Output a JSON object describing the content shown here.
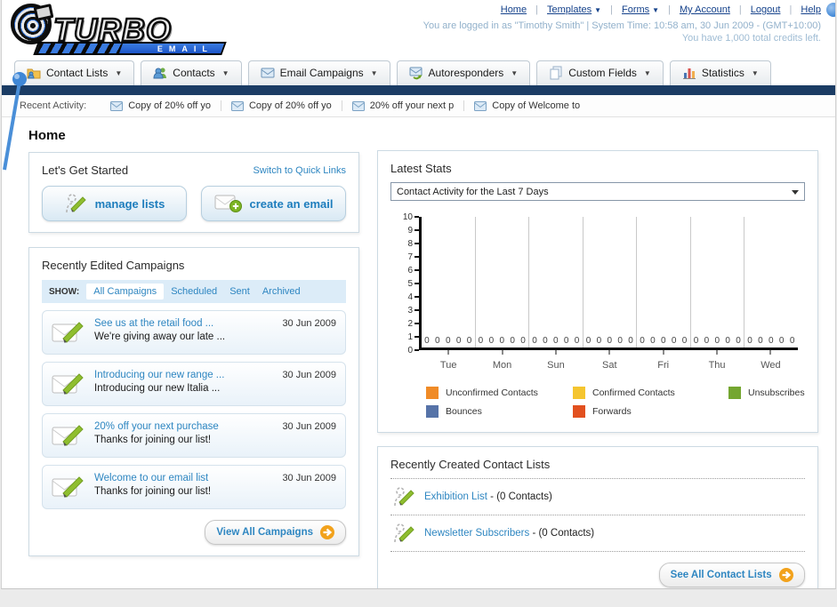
{
  "logo": {
    "brand": "TURBO",
    "sub": "EMAIL"
  },
  "topnav": {
    "links": [
      {
        "label": "Home",
        "dropdown": false
      },
      {
        "label": "Templates",
        "dropdown": true
      },
      {
        "label": "Forms",
        "dropdown": true
      },
      {
        "label": "My Account",
        "dropdown": false
      },
      {
        "label": "Logout",
        "dropdown": false
      },
      {
        "label": "Help",
        "dropdown": false
      }
    ],
    "session_line": "You are logged in as \"Timothy Smith\" | System Time: 10:58 am, 30 Jun 2009 - (GMT+10:00)",
    "credits_line": "You have 1,000 total credits left."
  },
  "main_tabs": [
    {
      "label": "Contact Lists",
      "icon": "contact-lists-icon"
    },
    {
      "label": "Contacts",
      "icon": "contacts-icon"
    },
    {
      "label": "Email Campaigns",
      "icon": "email-campaigns-icon"
    },
    {
      "label": "Autoresponders",
      "icon": "autoresponders-icon"
    },
    {
      "label": "Custom Fields",
      "icon": "custom-fields-icon"
    },
    {
      "label": "Statistics",
      "icon": "statistics-icon"
    }
  ],
  "recent_activity": {
    "label": "Recent Activity:",
    "items": [
      "Copy of 20% off yo",
      "Copy of 20% off yo",
      "20% off your next p",
      "Copy of Welcome to"
    ]
  },
  "page_title": "Home",
  "get_started": {
    "title": "Let's Get Started",
    "switch_link": "Switch to Quick Links",
    "buttons": [
      {
        "label": "manage lists"
      },
      {
        "label": "create an email"
      }
    ]
  },
  "campaigns": {
    "title": "Recently Edited Campaigns",
    "show_label": "SHOW:",
    "filters": [
      "All Campaigns",
      "Scheduled",
      "Sent",
      "Archived"
    ],
    "active_filter": "All Campaigns",
    "items": [
      {
        "title": "See us at the retail food ...",
        "subtitle": "We're giving away our late ...",
        "date": "30 Jun 2009"
      },
      {
        "title": "Introducing our new range ...",
        "subtitle": "Introducing our new Italia ...",
        "date": "30 Jun 2009"
      },
      {
        "title": "20% off your next purchase",
        "subtitle": "Thanks for joining our list!",
        "date": "30 Jun 2009"
      },
      {
        "title": "Welcome to our email list",
        "subtitle": "Thanks for joining our list!",
        "date": "30 Jun 2009"
      }
    ],
    "view_all_label": "View All Campaigns"
  },
  "stats": {
    "title": "Latest Stats",
    "selector_value": "Contact Activity for the Last 7 Days"
  },
  "chart_data": {
    "type": "bar",
    "title": "Contact Activity for the Last 7 Days",
    "categories": [
      "Tue",
      "Mon",
      "Sun",
      "Sat",
      "Fri",
      "Thu",
      "Wed"
    ],
    "series": [
      {
        "name": "Unconfirmed Contacts",
        "color": "#f08b27",
        "values": [
          0,
          0,
          0,
          0,
          0,
          0,
          0
        ]
      },
      {
        "name": "Confirmed Contacts",
        "color": "#f5c52f",
        "values": [
          0,
          0,
          0,
          0,
          0,
          0,
          0
        ]
      },
      {
        "name": "Unsubscribes",
        "color": "#74a630",
        "values": [
          0,
          0,
          0,
          0,
          0,
          0,
          0
        ]
      },
      {
        "name": "Bounces",
        "color": "#5673a8",
        "values": [
          0,
          0,
          0,
          0,
          0,
          0,
          0
        ]
      },
      {
        "name": "Forwards",
        "color": "#e2501f",
        "values": [
          0,
          0,
          0,
          0,
          0,
          0,
          0
        ]
      }
    ],
    "ylim": [
      0,
      10
    ],
    "yticks": [
      0,
      1,
      2,
      3,
      4,
      5,
      6,
      7,
      8,
      9,
      10
    ],
    "grid": "vertical-group-separators",
    "legend_position": "bottom"
  },
  "contact_lists": {
    "title": "Recently Created Contact Lists",
    "items": [
      {
        "name": "Exhibition List",
        "detail": "- (0 Contacts)"
      },
      {
        "name": "Newsletter Subscribers",
        "detail": "- (0 Contacts)"
      }
    ],
    "see_all_label": "See All Contact Lists"
  }
}
